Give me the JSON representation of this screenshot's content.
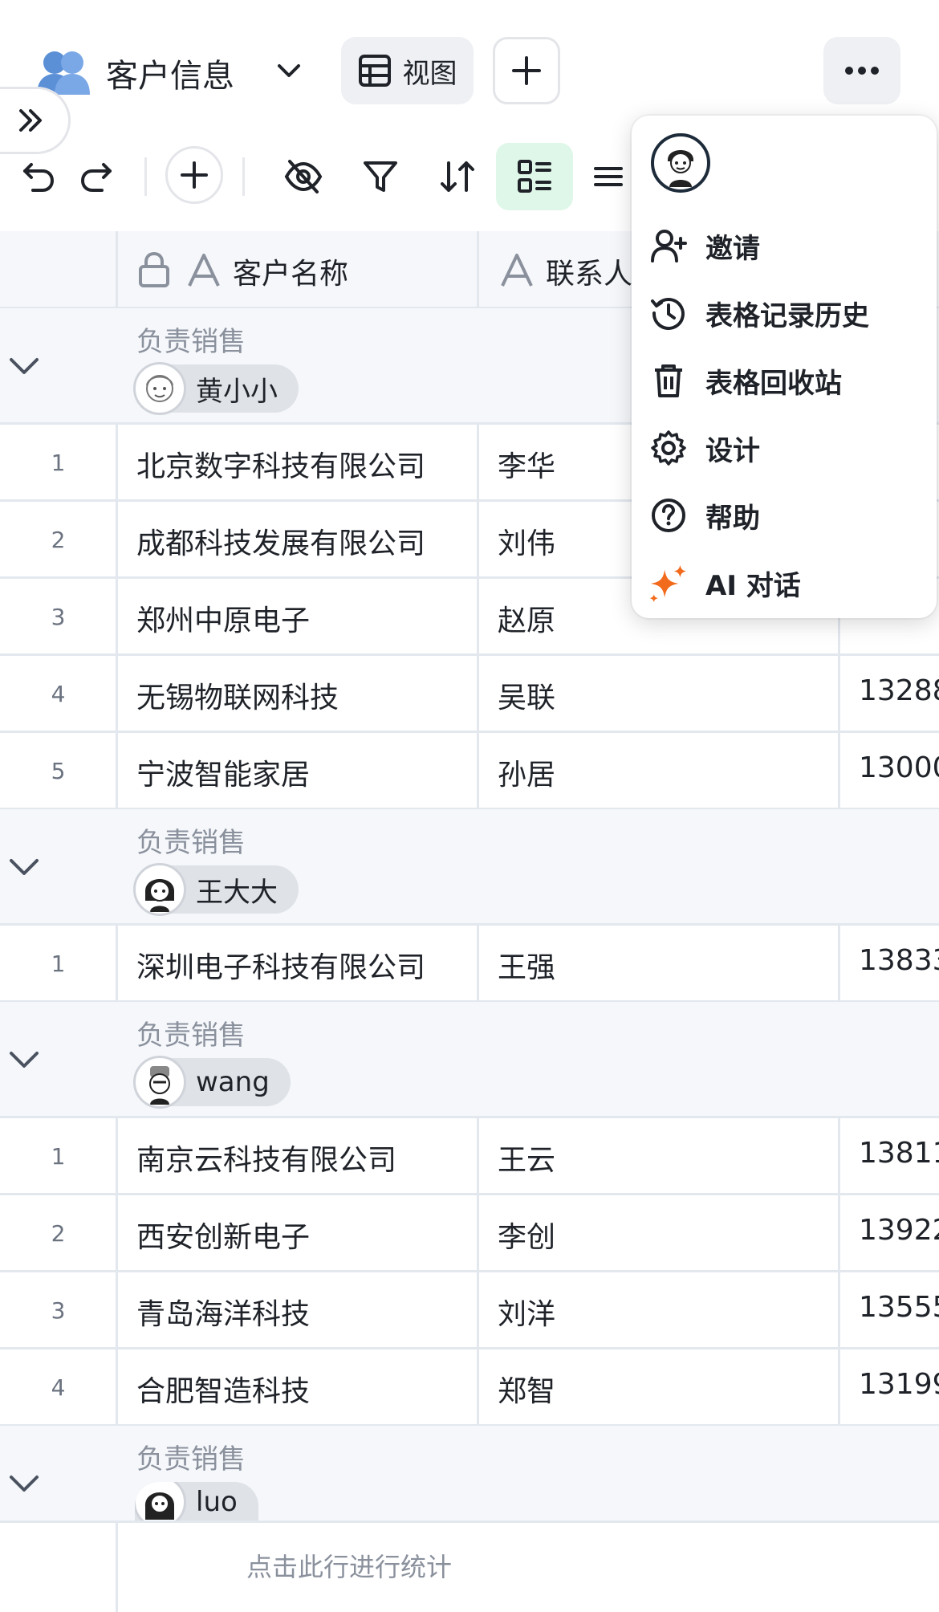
{
  "header": {
    "table_name": "客户信息",
    "view_label": "视图",
    "more_icon": "ellipsis-icon",
    "expand_icon": "double-chevron-right-icon"
  },
  "toolbar": {
    "icons": [
      "undo-icon",
      "redo-icon",
      "add-icon",
      "hide-fields-icon",
      "filter-icon",
      "sort-icon",
      "group-icon",
      "row-height-icon"
    ]
  },
  "columns": {
    "name": "客户名称",
    "contact": "联系人"
  },
  "groups": [
    {
      "label": "负责销售",
      "owner": "黄小小",
      "rows": [
        {
          "num": "1",
          "name": "北京数字科技有限公司",
          "contact": "李华",
          "phone": ""
        },
        {
          "num": "2",
          "name": "成都科技发展有限公司",
          "contact": "刘伟",
          "phone": ""
        },
        {
          "num": "3",
          "name": "郑州中原电子",
          "contact": "赵原",
          "phone": ""
        },
        {
          "num": "4",
          "name": "无锡物联网科技",
          "contact": "吴联",
          "phone": "13288"
        },
        {
          "num": "5",
          "name": "宁波智能家居",
          "contact": "孙居",
          "phone": "13000"
        }
      ]
    },
    {
      "label": "负责销售",
      "owner": "王大大",
      "rows": [
        {
          "num": "1",
          "name": "深圳电子科技有限公司",
          "contact": "王强",
          "phone": "13833"
        }
      ]
    },
    {
      "label": "负责销售",
      "owner": "wang",
      "rows": [
        {
          "num": "1",
          "name": "南京云科技有限公司",
          "contact": "王云",
          "phone": "13811"
        },
        {
          "num": "2",
          "name": "西安创新电子",
          "contact": "李创",
          "phone": "13922"
        },
        {
          "num": "3",
          "name": "青岛海洋科技",
          "contact": "刘洋",
          "phone": "13555"
        },
        {
          "num": "4",
          "name": "合肥智造科技",
          "contact": "郑智",
          "phone": "13199"
        }
      ]
    },
    {
      "label": "负责销售",
      "owner": "luo",
      "rows": []
    }
  ],
  "footer": {
    "stats_label": "点击此行进行统计"
  },
  "menu": {
    "items": [
      {
        "label": "邀请",
        "icon": "add-user-icon"
      },
      {
        "label": "表格记录历史",
        "icon": "history-icon"
      },
      {
        "label": "表格回收站",
        "icon": "trash-icon"
      },
      {
        "label": "设计",
        "icon": "gear-icon"
      },
      {
        "label": "帮助",
        "icon": "help-icon"
      },
      {
        "label": "AI 对话",
        "icon": "sparkle-icon"
      }
    ]
  },
  "colors": {
    "accent_green": "#dff7e8",
    "ai_orange": "#f26a1b",
    "grid_line": "#e3e8ef"
  }
}
